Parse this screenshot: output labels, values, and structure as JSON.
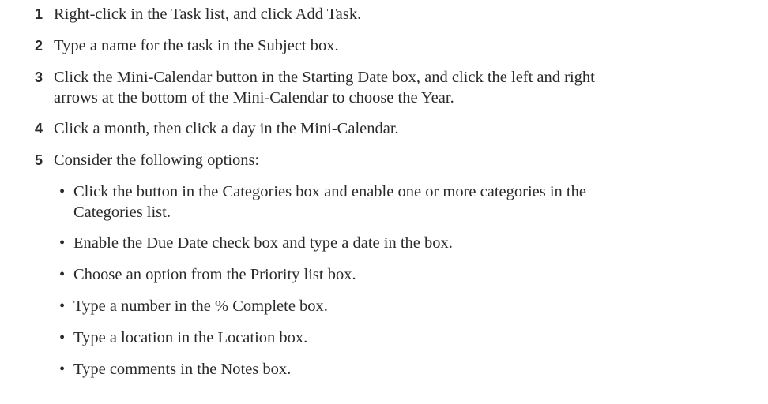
{
  "steps": [
    {
      "num": "1",
      "lines": [
        "Right-click in the Task list, and click Add Task."
      ]
    },
    {
      "num": "2",
      "lines": [
        "Type a name for the task in the Subject box."
      ]
    },
    {
      "num": "3",
      "lines": [
        "Click the Mini-Calendar button in the Starting Date box, and click the left and right",
        "arrows at the bottom of the Mini-Calendar to choose the Year."
      ]
    },
    {
      "num": "4",
      "lines": [
        "Click a month, then click a day in the Mini-Calendar."
      ]
    },
    {
      "num": "5",
      "lines": [
        "Consider the following options:"
      ]
    }
  ],
  "bullets": [
    {
      "lines": [
        "Click the button in the Categories box and enable one or more categories in the",
        "Categories list."
      ]
    },
    {
      "lines": [
        "Enable the Due Date check box and type a date in the box."
      ]
    },
    {
      "lines": [
        "Choose an option from the Priority list box."
      ]
    },
    {
      "lines": [
        "Type a number in the % Complete box."
      ]
    },
    {
      "lines": [
        "Type a location in the Location box."
      ]
    },
    {
      "lines": [
        "Type comments in the Notes box."
      ]
    }
  ],
  "bullet_char": "•"
}
